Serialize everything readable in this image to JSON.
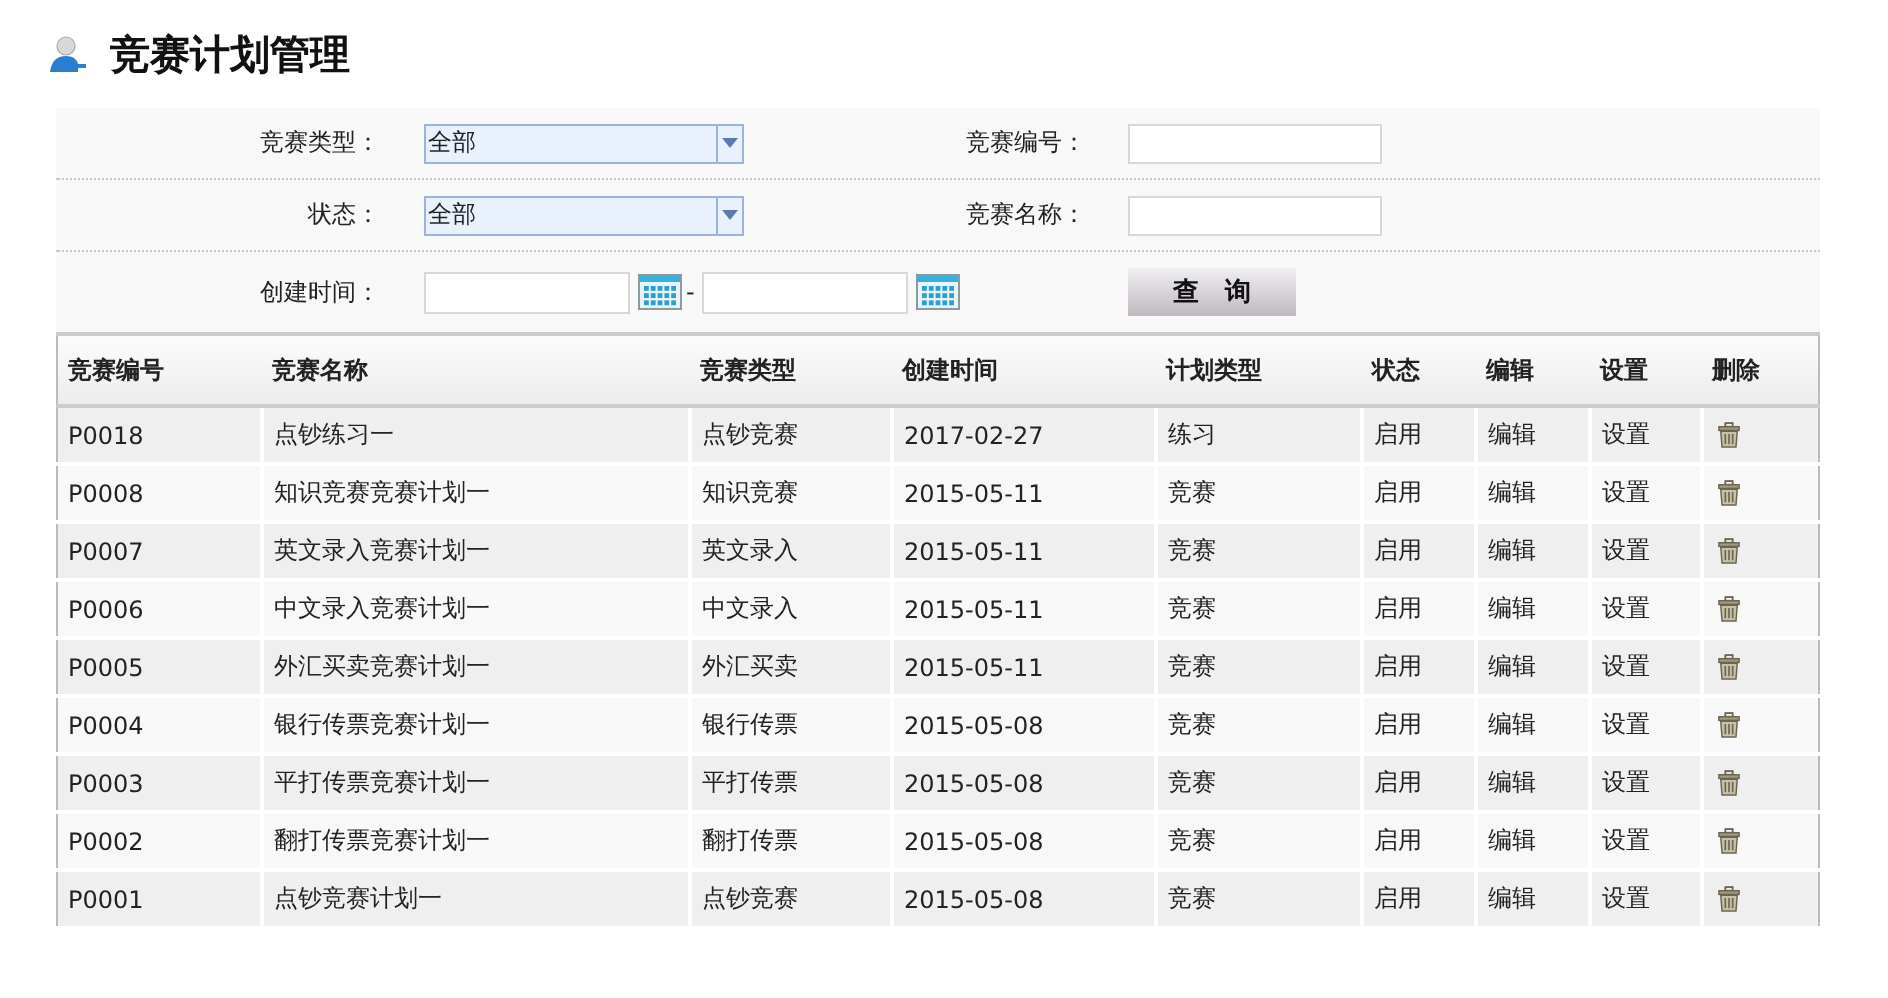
{
  "page": {
    "title": "竞赛计划管理"
  },
  "filters": [
    {
      "kind": "select",
      "label": "竞赛类型：",
      "value": "全部"
    },
    {
      "kind": "text",
      "label": "竞赛编号："
    },
    {
      "kind": "select",
      "label": "状态：",
      "value": "全部"
    },
    {
      "kind": "text",
      "label": "竞赛名称："
    },
    {
      "kind": "daterange",
      "label": "创建时间：",
      "separator": "-"
    }
  ],
  "search_button": "查　询",
  "table": {
    "columns": [
      "竞赛编号",
      "竞赛名称",
      "竞赛类型",
      "创建时间",
      "计划类型",
      "状态",
      "编辑",
      "设置",
      "删除"
    ],
    "rows": [
      [
        "P0018",
        "点钞练习一",
        "点钞竞赛",
        "2017-02-27",
        "练习",
        "启用",
        "编辑",
        "设置"
      ],
      [
        "P0008",
        "知识竞赛竞赛计划一",
        "知识竞赛",
        "2015-05-11",
        "竞赛",
        "启用",
        "编辑",
        "设置"
      ],
      [
        "P0007",
        "英文录入竞赛计划一",
        "英文录入",
        "2015-05-11",
        "竞赛",
        "启用",
        "编辑",
        "设置"
      ],
      [
        "P0006",
        "中文录入竞赛计划一",
        "中文录入",
        "2015-05-11",
        "竞赛",
        "启用",
        "编辑",
        "设置"
      ],
      [
        "P0005",
        "外汇买卖竞赛计划一",
        "外汇买卖",
        "2015-05-11",
        "竞赛",
        "启用",
        "编辑",
        "设置"
      ],
      [
        "P0004",
        "银行传票竞赛计划一",
        "银行传票",
        "2015-05-08",
        "竞赛",
        "启用",
        "编辑",
        "设置"
      ],
      [
        "P0003",
        "平打传票竞赛计划一",
        "平打传票",
        "2015-05-08",
        "竞赛",
        "启用",
        "编辑",
        "设置"
      ],
      [
        "P0002",
        "翻打传票竞赛计划一",
        "翻打传票",
        "2015-05-08",
        "竞赛",
        "启用",
        "编辑",
        "设置"
      ],
      [
        "P0001",
        "点钞竞赛计划一",
        "点钞竞赛",
        "2015-05-08",
        "竞赛",
        "启用",
        "编辑",
        "设置"
      ]
    ]
  }
}
